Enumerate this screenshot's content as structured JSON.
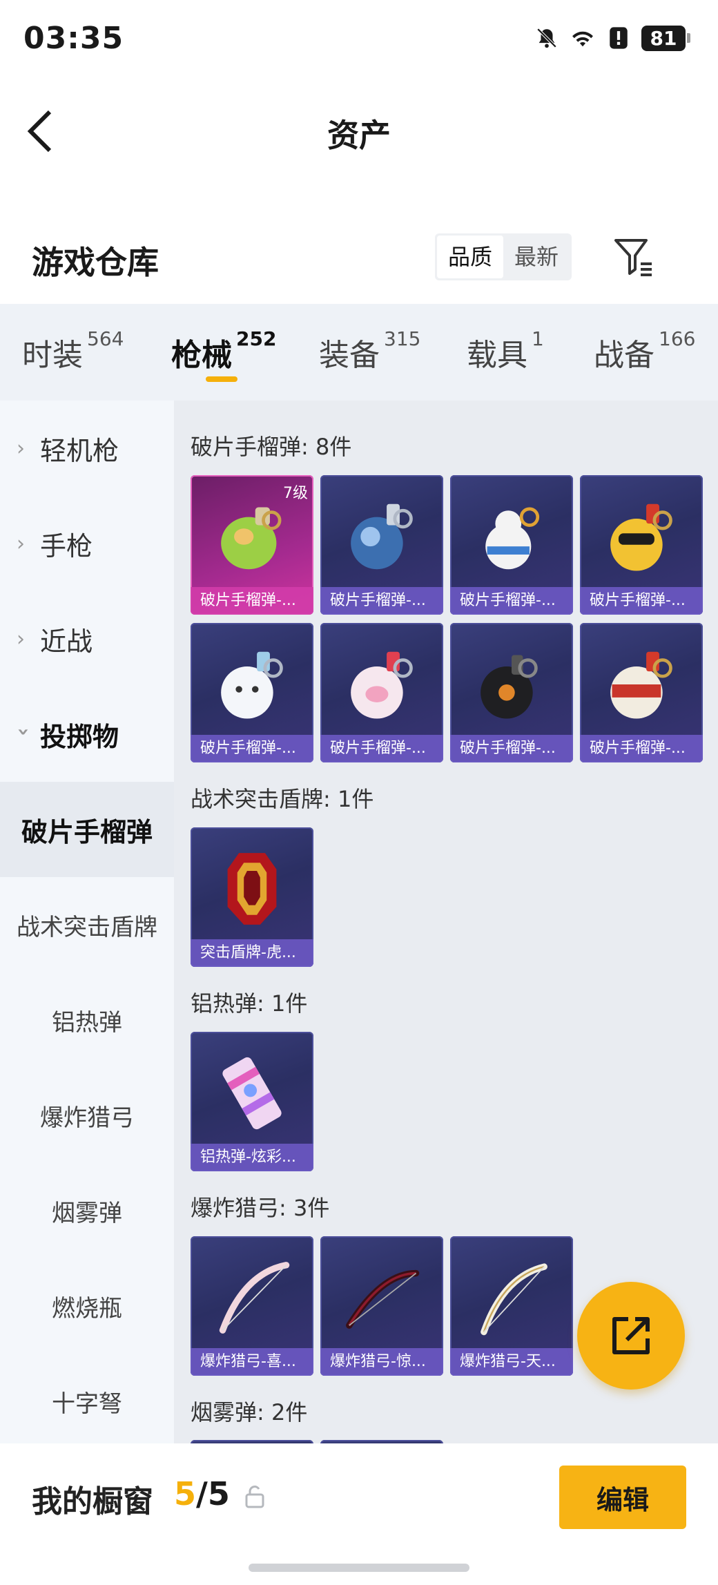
{
  "status": {
    "time": "03:35",
    "battery": "81"
  },
  "header": {
    "title": "资产"
  },
  "warehouse": {
    "title": "游戏仓库",
    "sort_options": [
      "品质",
      "最新"
    ]
  },
  "tabs": [
    {
      "label": "时装",
      "count": "564"
    },
    {
      "label": "枪械",
      "count": "252"
    },
    {
      "label": "装备",
      "count": "315"
    },
    {
      "label": "载具",
      "count": "1"
    },
    {
      "label": "战备",
      "count": "166"
    }
  ],
  "sidebar": {
    "parents": [
      "轻机枪",
      "手枪",
      "近战",
      "投掷物"
    ],
    "subs": [
      "破片手榴弹",
      "战术突击盾牌",
      "铝热弹",
      "爆炸猎弓",
      "烟雾弹",
      "燃烧瓶",
      "十字弩"
    ]
  },
  "sections": [
    {
      "title": "破片手榴弹: 8件",
      "items": [
        {
          "label": "破片手榴弹-...",
          "level": "7级"
        },
        {
          "label": "破片手榴弹-..."
        },
        {
          "label": "破片手榴弹-..."
        },
        {
          "label": "破片手榴弹-..."
        },
        {
          "label": "破片手榴弹-..."
        },
        {
          "label": "破片手榴弹-..."
        },
        {
          "label": "破片手榴弹-..."
        },
        {
          "label": "破片手榴弹-..."
        }
      ]
    },
    {
      "title": "战术突击盾牌: 1件",
      "items": [
        {
          "label": "突击盾牌-虎..."
        }
      ]
    },
    {
      "title": "铝热弹: 1件",
      "items": [
        {
          "label": "铝热弹-炫彩..."
        }
      ]
    },
    {
      "title": "爆炸猎弓: 3件",
      "items": [
        {
          "label": "爆炸猎弓-喜..."
        },
        {
          "label": "爆炸猎弓-惊..."
        },
        {
          "label": "爆炸猎弓-天..."
        }
      ]
    },
    {
      "title": "烟雾弹: 2件",
      "items": []
    }
  ],
  "bottom": {
    "my_window": "我的橱窗",
    "count_current": "5",
    "count_sep": "/",
    "count_total": "5",
    "edit": "编辑"
  },
  "colors": {
    "accent": "#F7B314",
    "card_blue": "#2B2F63",
    "card_pink": "#A42A8F"
  }
}
